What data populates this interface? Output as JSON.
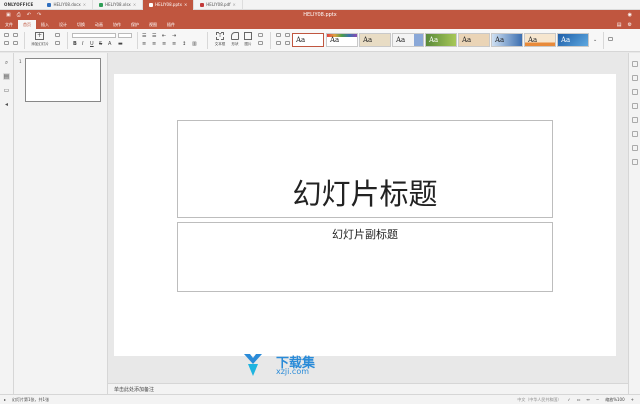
{
  "app": {
    "brand": "ONLYOFFICE",
    "title": "HELIY08.pptx"
  },
  "file_tabs": [
    {
      "label": "HELIY08.docx",
      "color": "#2f6fbf"
    },
    {
      "label": "HELIY08.xlsx",
      "color": "#2f9e57"
    },
    {
      "label": "HELIY08.pptx",
      "color": "#c0563f",
      "active": true
    },
    {
      "label": "HELIY08.pdf",
      "color": "#c23b3b"
    }
  ],
  "menu": [
    "文件",
    "首页",
    "插入",
    "设计",
    "切换",
    "动画",
    "协作",
    "保护",
    "视图",
    "插件"
  ],
  "toolbar": {
    "add_slide_label": "添加幻灯片",
    "shape_label": "形状",
    "image_label": "图片",
    "text_label": "文本框",
    "theme_sample": "Aa"
  },
  "themes": [
    {
      "name": "blank",
      "color": "#ffffff",
      "selected": true
    },
    {
      "name": "colorful",
      "color": "#e04040"
    },
    {
      "name": "beige",
      "color": "#d8c8a8"
    },
    {
      "name": "office",
      "color": "#f0f0f0"
    },
    {
      "name": "blue-bar",
      "color": "#7a9acc"
    },
    {
      "name": "green",
      "color": "#6aa84f"
    },
    {
      "name": "warm",
      "color": "#e8d0b0"
    },
    {
      "name": "dark-blue",
      "color": "#3d6fb0"
    },
    {
      "name": "orange",
      "color": "#e88a3a"
    },
    {
      "name": "cyan",
      "color": "#2e7bc4"
    }
  ],
  "thumbnails": [
    {
      "number": "1"
    }
  ],
  "slide": {
    "title": "幻灯片标题",
    "subtitle": "幻灯片副标题"
  },
  "notes_placeholder": "单击此处添加备注",
  "status": {
    "slide_count": "幻灯片第1张，共1张",
    "language": "中文（中华人民共和国）",
    "zoom": "缩放%100"
  },
  "watermark": {
    "line1": "下载集",
    "line2": "xzji.com"
  },
  "colors": {
    "accent": "#c0563f",
    "watermark": "#2a8bd8"
  }
}
